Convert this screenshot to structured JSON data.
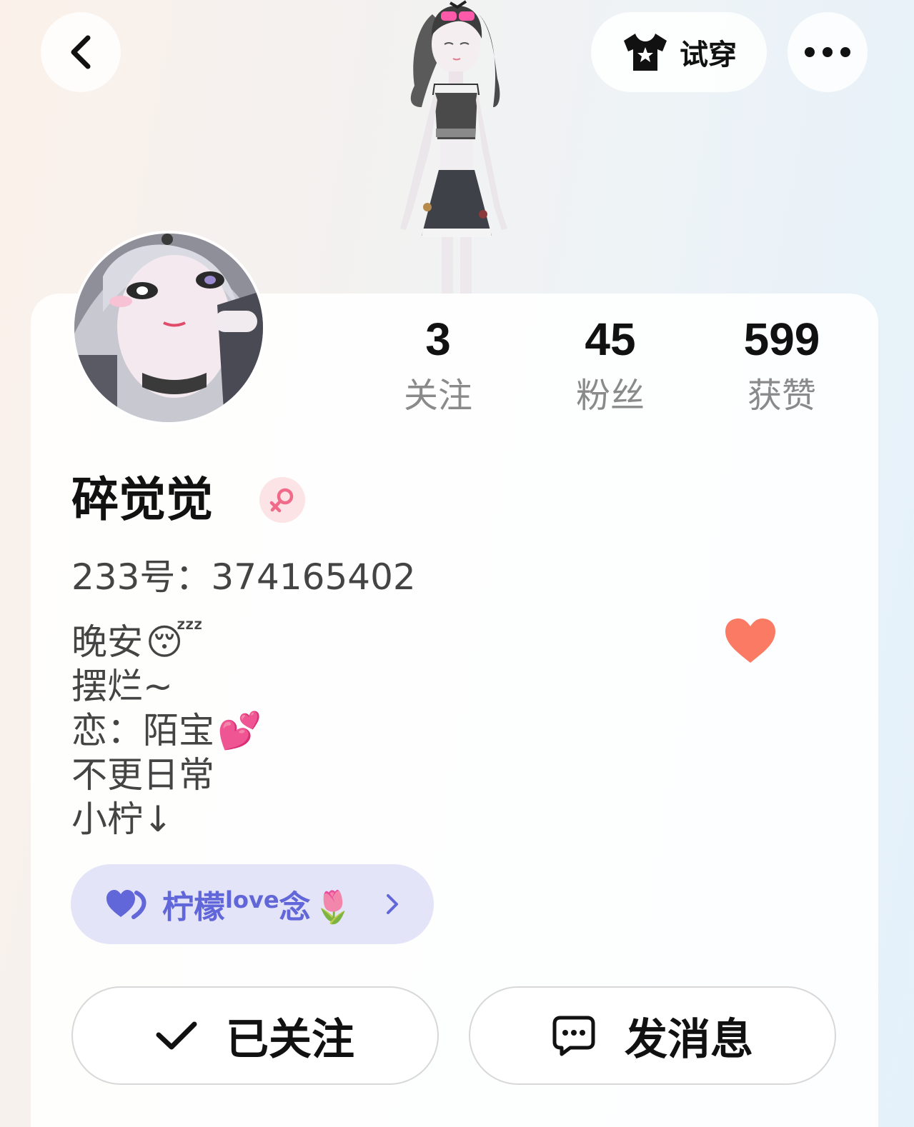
{
  "topbar": {
    "back_icon": "chevron-left-icon",
    "tryon_icon": "tshirt-star-icon",
    "tryon_label": "试穿",
    "more_icon": "more-dots-icon"
  },
  "profile": {
    "stats": [
      {
        "value": "3",
        "label": "关注"
      },
      {
        "value": "45",
        "label": "粉丝"
      },
      {
        "value": "599",
        "label": "获赞"
      }
    ],
    "username": "碎觉觉",
    "gender": "female",
    "gender_color": "#f06a8a",
    "id_line": "233号：374165402",
    "bio": [
      {
        "text": "晚安",
        "emoji": "😴"
      },
      {
        "text": "摆烂~",
        "emoji": ""
      },
      {
        "text": "恋：陌宝",
        "emoji": "💕"
      },
      {
        "text": "不更日常",
        "emoji": ""
      },
      {
        "text": "小柠↓",
        "emoji": ""
      }
    ],
    "heart_color": "#fb7a63"
  },
  "tag": {
    "icon": "double-heart-icon",
    "text_main": "柠檬",
    "text_sup": "love",
    "text_end": "念",
    "emoji": "🌷",
    "accent": "#6166d8"
  },
  "actions": {
    "followed_label": "已关注",
    "message_label": "发消息"
  }
}
